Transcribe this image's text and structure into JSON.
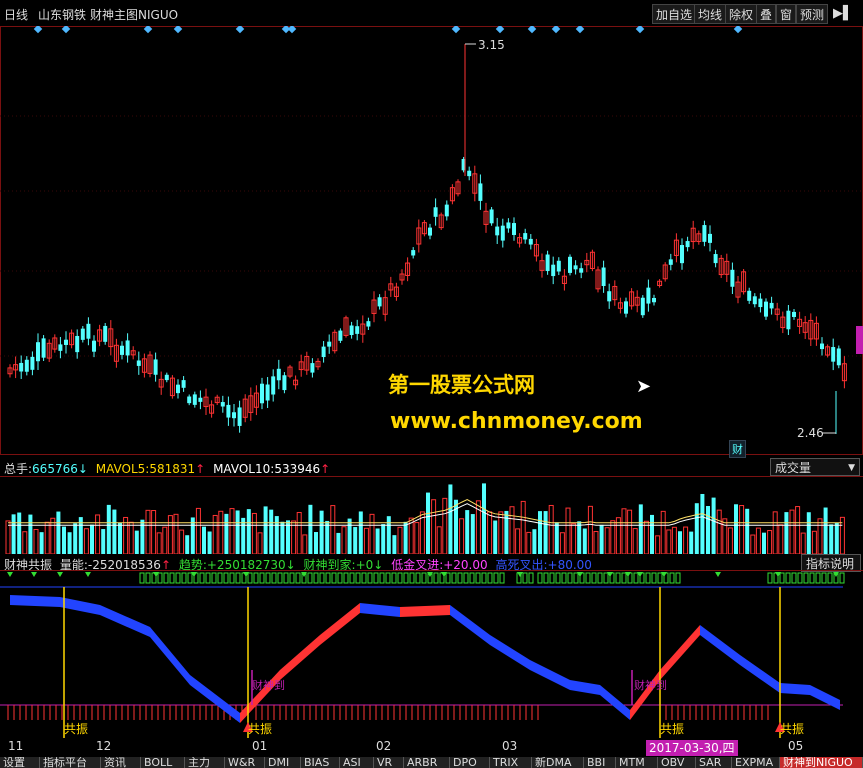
{
  "header": {
    "period": "日线",
    "stock": "山东钢铁",
    "formula": "财神主图NIGUO",
    "buttons": [
      "加自选",
      "均线",
      "除权",
      "叠",
      "窗",
      "预测"
    ]
  },
  "main_chart": {
    "high_label": "3.15",
    "low_label": "2.46",
    "corner_badge": "财"
  },
  "watermark": {
    "title": "第一股票公式网",
    "url": "www.chnmoney.com"
  },
  "volume_panel": {
    "total_label": "总手:",
    "total_value": "665766",
    "total_arrow": "↓",
    "mavol5_label": "MAVOL5:",
    "mavol5_value": "581831",
    "mavol5_arrow": "↑",
    "mavol10_label": "MAVOL10:",
    "mavol10_value": "533946",
    "mavol10_arrow": "↑",
    "selector": "成交量"
  },
  "indicator_panel": {
    "name": "财神共振",
    "energy_label": "量能:",
    "energy_value": "-252018536",
    "energy_arrow": "↑",
    "trend_label": "趋势:",
    "trend_value": "+250182730",
    "trend_arrow": "↓",
    "god_label": "财神到家:",
    "god_value": "+0",
    "god_arrow": "↓",
    "low_gold_label": "低金叉进:",
    "low_gold_value": "+20.00",
    "high_dead_label": "高死叉出:",
    "high_dead_value": "+80.00",
    "help_button": "指标说明",
    "resonance_labels": [
      "共振",
      "共振",
      "共振",
      "共振"
    ],
    "god_signals": [
      "财神到",
      "财神到"
    ]
  },
  "time_axis": {
    "labels": [
      "11",
      "12",
      "01",
      "02",
      "03",
      "05"
    ],
    "cursor_date": "2017-03-30,四"
  },
  "tabs": [
    "设置",
    "指标平台",
    "资讯",
    "BOLL",
    "主力",
    "W&R",
    "DMI",
    "BIAS",
    "ASI",
    "VR",
    "ARBR",
    "DPO",
    "TRIX",
    "新DMA",
    "BBI",
    "MTM",
    "OBV",
    "SAR",
    "EXPMA",
    "财神到NIGUO"
  ],
  "colors": {
    "up": "#ff3333",
    "down": "#54ffff",
    "accent_yellow": "#ffd700",
    "signal_green": "#33dd33",
    "trend_blue": "#2244ff",
    "magenta": "#c21fb0"
  }
}
